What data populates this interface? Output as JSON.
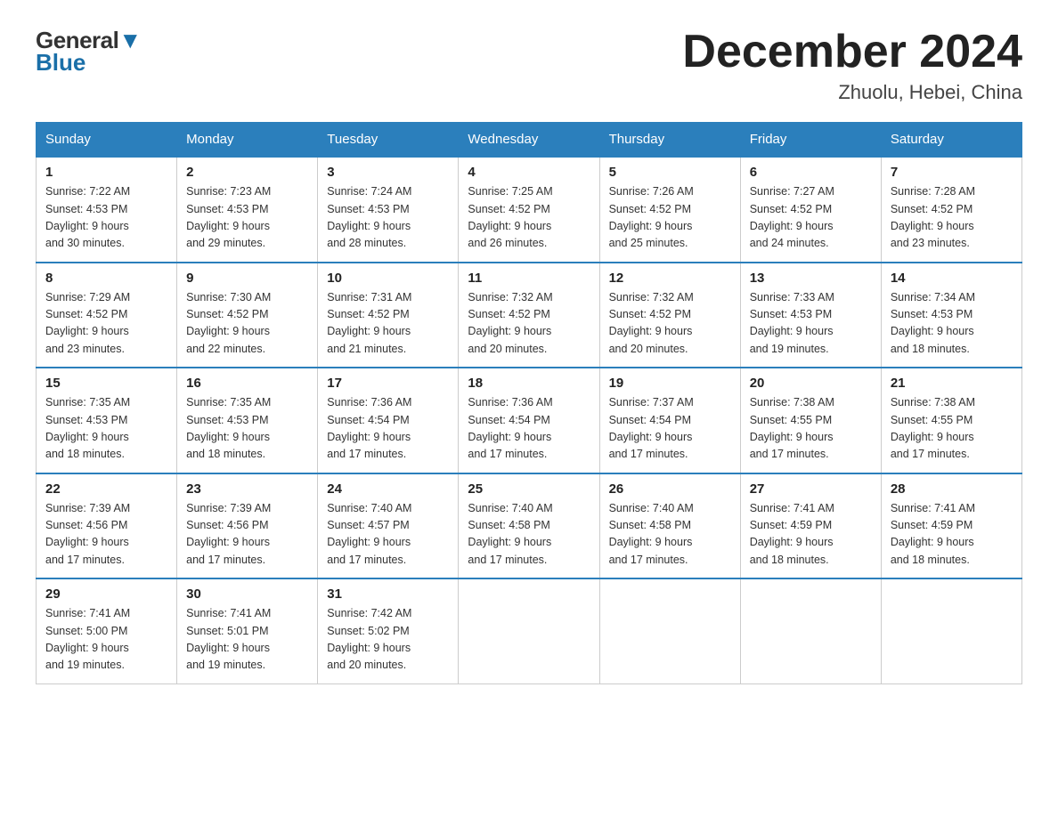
{
  "header": {
    "logo_general": "General",
    "logo_blue": "Blue",
    "month_title": "December 2024",
    "location": "Zhuolu, Hebei, China"
  },
  "weekdays": [
    "Sunday",
    "Monday",
    "Tuesday",
    "Wednesday",
    "Thursday",
    "Friday",
    "Saturday"
  ],
  "weeks": [
    [
      {
        "day": "1",
        "sunrise": "7:22 AM",
        "sunset": "4:53 PM",
        "daylight": "9 hours and 30 minutes."
      },
      {
        "day": "2",
        "sunrise": "7:23 AM",
        "sunset": "4:53 PM",
        "daylight": "9 hours and 29 minutes."
      },
      {
        "day": "3",
        "sunrise": "7:24 AM",
        "sunset": "4:53 PM",
        "daylight": "9 hours and 28 minutes."
      },
      {
        "day": "4",
        "sunrise": "7:25 AM",
        "sunset": "4:52 PM",
        "daylight": "9 hours and 26 minutes."
      },
      {
        "day": "5",
        "sunrise": "7:26 AM",
        "sunset": "4:52 PM",
        "daylight": "9 hours and 25 minutes."
      },
      {
        "day": "6",
        "sunrise": "7:27 AM",
        "sunset": "4:52 PM",
        "daylight": "9 hours and 24 minutes."
      },
      {
        "day": "7",
        "sunrise": "7:28 AM",
        "sunset": "4:52 PM",
        "daylight": "9 hours and 23 minutes."
      }
    ],
    [
      {
        "day": "8",
        "sunrise": "7:29 AM",
        "sunset": "4:52 PM",
        "daylight": "9 hours and 23 minutes."
      },
      {
        "day": "9",
        "sunrise": "7:30 AM",
        "sunset": "4:52 PM",
        "daylight": "9 hours and 22 minutes."
      },
      {
        "day": "10",
        "sunrise": "7:31 AM",
        "sunset": "4:52 PM",
        "daylight": "9 hours and 21 minutes."
      },
      {
        "day": "11",
        "sunrise": "7:32 AM",
        "sunset": "4:52 PM",
        "daylight": "9 hours and 20 minutes."
      },
      {
        "day": "12",
        "sunrise": "7:32 AM",
        "sunset": "4:52 PM",
        "daylight": "9 hours and 20 minutes."
      },
      {
        "day": "13",
        "sunrise": "7:33 AM",
        "sunset": "4:53 PM",
        "daylight": "9 hours and 19 minutes."
      },
      {
        "day": "14",
        "sunrise": "7:34 AM",
        "sunset": "4:53 PM",
        "daylight": "9 hours and 18 minutes."
      }
    ],
    [
      {
        "day": "15",
        "sunrise": "7:35 AM",
        "sunset": "4:53 PM",
        "daylight": "9 hours and 18 minutes."
      },
      {
        "day": "16",
        "sunrise": "7:35 AM",
        "sunset": "4:53 PM",
        "daylight": "9 hours and 18 minutes."
      },
      {
        "day": "17",
        "sunrise": "7:36 AM",
        "sunset": "4:54 PM",
        "daylight": "9 hours and 17 minutes."
      },
      {
        "day": "18",
        "sunrise": "7:36 AM",
        "sunset": "4:54 PM",
        "daylight": "9 hours and 17 minutes."
      },
      {
        "day": "19",
        "sunrise": "7:37 AM",
        "sunset": "4:54 PM",
        "daylight": "9 hours and 17 minutes."
      },
      {
        "day": "20",
        "sunrise": "7:38 AM",
        "sunset": "4:55 PM",
        "daylight": "9 hours and 17 minutes."
      },
      {
        "day": "21",
        "sunrise": "7:38 AM",
        "sunset": "4:55 PM",
        "daylight": "9 hours and 17 minutes."
      }
    ],
    [
      {
        "day": "22",
        "sunrise": "7:39 AM",
        "sunset": "4:56 PM",
        "daylight": "9 hours and 17 minutes."
      },
      {
        "day": "23",
        "sunrise": "7:39 AM",
        "sunset": "4:56 PM",
        "daylight": "9 hours and 17 minutes."
      },
      {
        "day": "24",
        "sunrise": "7:40 AM",
        "sunset": "4:57 PM",
        "daylight": "9 hours and 17 minutes."
      },
      {
        "day": "25",
        "sunrise": "7:40 AM",
        "sunset": "4:58 PM",
        "daylight": "9 hours and 17 minutes."
      },
      {
        "day": "26",
        "sunrise": "7:40 AM",
        "sunset": "4:58 PM",
        "daylight": "9 hours and 17 minutes."
      },
      {
        "day": "27",
        "sunrise": "7:41 AM",
        "sunset": "4:59 PM",
        "daylight": "9 hours and 18 minutes."
      },
      {
        "day": "28",
        "sunrise": "7:41 AM",
        "sunset": "4:59 PM",
        "daylight": "9 hours and 18 minutes."
      }
    ],
    [
      {
        "day": "29",
        "sunrise": "7:41 AM",
        "sunset": "5:00 PM",
        "daylight": "9 hours and 19 minutes."
      },
      {
        "day": "30",
        "sunrise": "7:41 AM",
        "sunset": "5:01 PM",
        "daylight": "9 hours and 19 minutes."
      },
      {
        "day": "31",
        "sunrise": "7:42 AM",
        "sunset": "5:02 PM",
        "daylight": "9 hours and 20 minutes."
      },
      null,
      null,
      null,
      null
    ]
  ],
  "labels": {
    "sunrise": "Sunrise:",
    "sunset": "Sunset:",
    "daylight": "Daylight:"
  }
}
